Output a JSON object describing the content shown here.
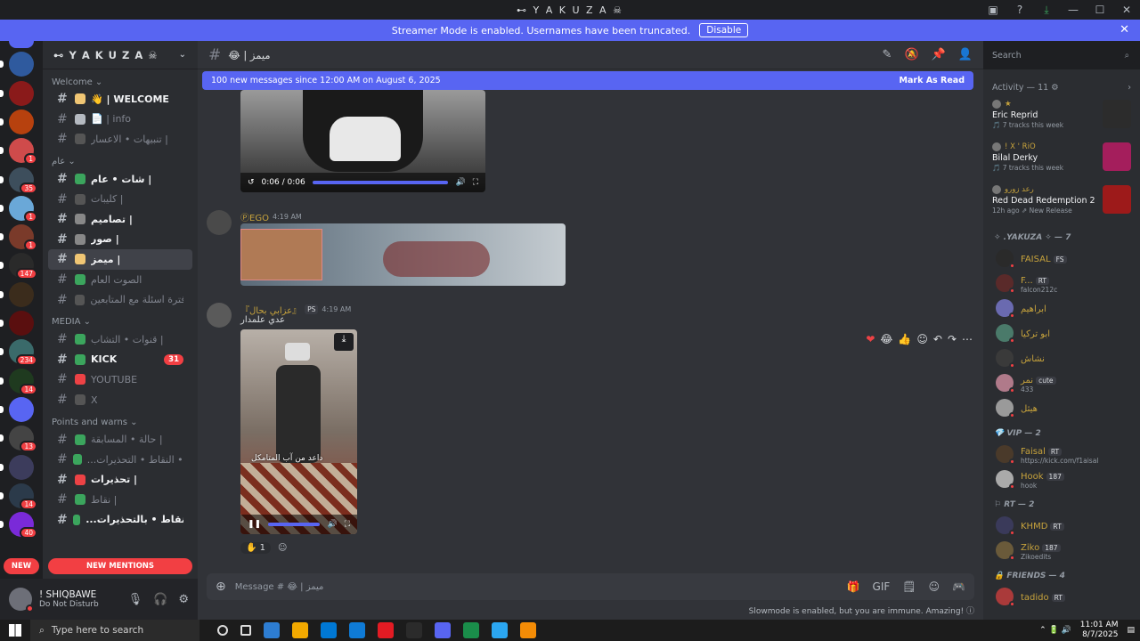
{
  "window": {
    "title": "⊷ Y A K U Z A ☠",
    "controls": [
      "▣",
      "?",
      "⤓",
      "—",
      "☐",
      "✕"
    ]
  },
  "banner": {
    "text": "Streamer Mode is enabled. Usernames have been truncated.",
    "button": "Disable",
    "close": "✕"
  },
  "guilds": [
    {
      "color": "#5865f2",
      "badge": ""
    },
    {
      "color": "#2f5a9e",
      "badge": ""
    },
    {
      "color": "#8a1a1a",
      "badge": ""
    },
    {
      "color": "#b7410e",
      "badge": ""
    },
    {
      "color": "#cf4b4b",
      "badge": "1"
    },
    {
      "color": "#3d4e5c",
      "badge": "35"
    },
    {
      "color": "#6aa8d8",
      "badge": "1"
    },
    {
      "color": "#7a3a2a",
      "badge": "1"
    },
    {
      "color": "#2a2a2a",
      "badge": "147"
    },
    {
      "color": "#3b2c1c",
      "badge": ""
    },
    {
      "color": "#5a0f0f",
      "badge": ""
    },
    {
      "color": "#3a6a6a",
      "badge": "234"
    },
    {
      "color": "#1f3a1f",
      "badge": "14"
    },
    {
      "color": "#5865f2",
      "badge": ""
    },
    {
      "color": "#444",
      "badge": "13"
    },
    {
      "color": "#3c3c5c",
      "badge": ""
    },
    {
      "color": "#2b3a4a",
      "badge": "14"
    },
    {
      "color": "#7a2ad8",
      "badge": "40"
    }
  ],
  "server": {
    "name": "⊷ Y A K U Z A ☠",
    "chevron": "⌄"
  },
  "categories": {
    "welcome": "Welcome ⌄",
    "general": "عام ⌄",
    "media": "MEDIA ⌄",
    "points": "Points and warns ⌄"
  },
  "channels": {
    "welcome": [
      {
        "label": "👋 | WELCOME",
        "unread": true,
        "emoji": "#f0c674",
        "count": ""
      },
      {
        "label": "📄 | info",
        "unread": false,
        "emoji": "#b5bac1",
        "count": ""
      },
      {
        "label": "تنبيهات • الاعسار |",
        "unread": false,
        "emoji": "#555",
        "count": ""
      }
    ],
    "general": [
      {
        "label": "شات • عام |",
        "unread": true,
        "emoji": "#3ba55d",
        "count": ""
      },
      {
        "label": "كليبات |",
        "unread": false,
        "emoji": "#555",
        "count": ""
      },
      {
        "label": "تصاميم |",
        "unread": true,
        "emoji": "#888",
        "count": ""
      },
      {
        "label": "صور |",
        "unread": true,
        "emoji": "#888",
        "count": ""
      },
      {
        "label": "ميمز |",
        "unread": true,
        "emoji": "#f0c674",
        "count": "",
        "active": true
      },
      {
        "label": "الصوت العام",
        "unread": false,
        "emoji": "#3ba55d",
        "count": ""
      },
      {
        "label": "فترة اسئلة مع المتابعين",
        "unread": false,
        "emoji": "#555",
        "count": ""
      }
    ],
    "media": [
      {
        "label": "قنوات • التشاب |",
        "unread": false,
        "emoji": "#3ba55d",
        "count": ""
      },
      {
        "label": "KICK",
        "unread": true,
        "emoji": "#3ba55d",
        "count": "31"
      },
      {
        "label": "YOUTUBE",
        "unread": false,
        "emoji": "#ed4245",
        "count": ""
      },
      {
        "label": "X",
        "unread": false,
        "emoji": "#555",
        "count": ""
      }
    ],
    "points": [
      {
        "label": "حالة • المسابقة |",
        "unread": false,
        "emoji": "#3ba55d",
        "count": ""
      },
      {
        "label": "...ين • النقاط • التحذيرات |",
        "unread": false,
        "emoji": "#3ba55d",
        "count": ""
      },
      {
        "label": "تحذيرات |",
        "unread": true,
        "emoji": "#ed4245",
        "count": ""
      },
      {
        "label": "نقاط |",
        "unread": false,
        "emoji": "#3ba55d",
        "count": ""
      },
      {
        "label": "...ال • النقاط • بالتحذيرات |",
        "unread": true,
        "emoji": "#3ba55d",
        "count": ""
      }
    ]
  },
  "pills": {
    "new": "NEW",
    "mentions": "NEW MENTIONS"
  },
  "user": {
    "name": "! SHIQBAWE",
    "status": "Do Not Disturb",
    "icons": [
      "🎙",
      "🎧",
      "⚙"
    ]
  },
  "header": {
    "hash": "#",
    "channel": "😂 | ميمز",
    "tools": [
      "✎",
      "🔕",
      "📌",
      "👤"
    ]
  },
  "newbar": {
    "text": "100 new messages since 12:00 AM on August 6, 2025",
    "mark": "Mark As Read"
  },
  "video1": {
    "time": "0:06 / 0:06"
  },
  "message1": {
    "name": "ⓅEGO",
    "time": "4:19 AM"
  },
  "message2": {
    "name": "『عزابي بحال』",
    "tag": "PS",
    "time": "4:19 AM",
    "text": "عدي علمدار",
    "caption": "داعد من آب المتامكل"
  },
  "hover": {
    "icons": [
      "❤",
      "😂",
      "👍",
      "☺",
      "↶",
      "↷",
      "⋯"
    ]
  },
  "reaction": {
    "count": "1"
  },
  "composer": {
    "placeholder": "Message # 😂 | ميمز",
    "plus": "⊕",
    "tools": [
      "🎁",
      "GIF",
      "🗒",
      "☺",
      "🎮"
    ]
  },
  "slowmode": "Slowmode is enabled, but you are immune. Amazing! ⓘ",
  "search": {
    "placeholder": "Search"
  },
  "activity": {
    "header": "Activity — 11 ⚙",
    "items": [
      {
        "who": "★",
        "title": "Eric Reprid",
        "sub": "🎵 7 tracks this week",
        "color": "#2c2c2c"
      },
      {
        "who": "! X ' RiO",
        "title": "Bilal Derky",
        "sub": "🎵 7 tracks this week",
        "color": "#a41e5c"
      },
      {
        "who": "رعد زورو",
        "title": "Red Dead Redemption 2",
        "sub": "12h ago  ⇗ New Release",
        "color": "#9d1a1a"
      }
    ]
  },
  "groups": [
    {
      "label": "✧ .YAKUZA ✧ — 7",
      "members": [
        {
          "name": "FAISAL",
          "tag": "FS",
          "status": "",
          "color": "#2a2a2a"
        },
        {
          "name": "F...",
          "tag": "RT",
          "status": "falcon212c",
          "color": "#5a2a2a"
        },
        {
          "name": "ابراهيم",
          "tag": "",
          "status": "",
          "color": "#6a6ab0"
        },
        {
          "name": "ابو تركيا",
          "tag": "",
          "status": "",
          "color": "#4a7a6a"
        },
        {
          "name": "نشاش",
          "tag": "",
          "status": "",
          "color": "#3a3a3a"
        },
        {
          "name": "نمر",
          "tag": "cute",
          "status": "433",
          "color": "#b07a8a"
        },
        {
          "name": "هيثل",
          "tag": "",
          "status": "",
          "color": "#9a9a9a"
        }
      ]
    },
    {
      "label": "💎 VIP — 2",
      "members": [
        {
          "name": "Faisal",
          "tag": "RT",
          "status": "https://kick.com/f1aisal",
          "color": "#4a3a2a"
        },
        {
          "name": "Hook",
          "tag": "187",
          "status": "hook",
          "color": "#aaaaaa"
        }
      ]
    },
    {
      "label": "⚐ RT — 2",
      "members": [
        {
          "name": "KHMD",
          "tag": "RT",
          "status": "",
          "color": "#3a3a5a"
        },
        {
          "name": "Ziko",
          "tag": "187",
          "status": "Zikoedits",
          "color": "#6a5a3a"
        }
      ]
    },
    {
      "label": "🔒 FRIENDS — 4",
      "members": [
        {
          "name": "tadido",
          "tag": "RT",
          "status": "",
          "color": "#aa3a3a"
        }
      ]
    }
  ],
  "taskbar": {
    "search": "Type here to search",
    "time": "11:01 AM",
    "date": "8/7/2025",
    "apps": [
      "#2d7dd2",
      "#f2a900",
      "#0078d4",
      "#0f7bd6",
      "#e31b23",
      "#2b2b2b",
      "#5865f2",
      "#1a8d4a",
      "#2ba6f0",
      "#f48c06"
    ]
  }
}
